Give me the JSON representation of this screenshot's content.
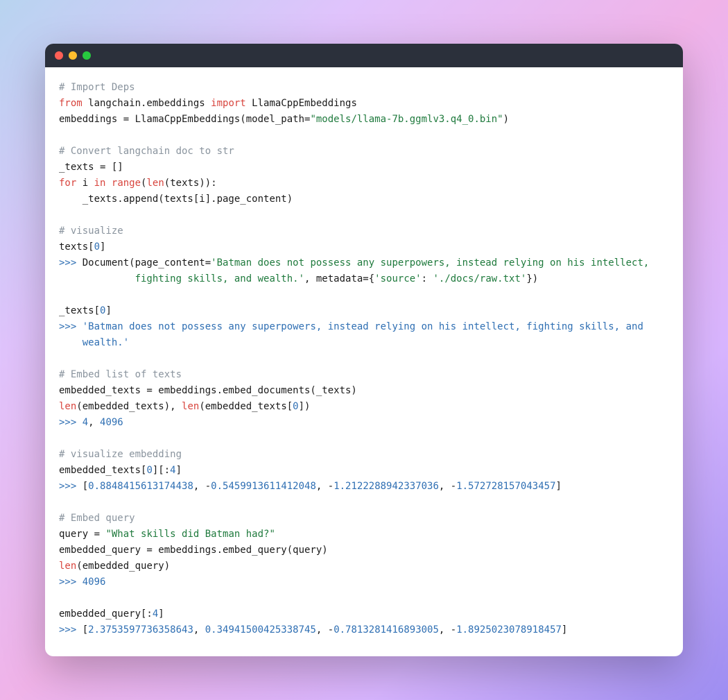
{
  "window": {
    "dots": [
      "close",
      "minimize",
      "zoom"
    ]
  },
  "code": {
    "comment_import": "# Import Deps",
    "kw_from": "from",
    "mod_langchain": " langchain.embeddings ",
    "kw_import": "import",
    "cls_llama": " LlamaCppEmbeddings",
    "assign_emb": "embeddings = LlamaCppEmbeddings(model_path=",
    "str_model": "\"models/llama-7b.ggmlv3.q4_0.bin\"",
    "paren_close": ")",
    "comment_convert": "# Convert langchain doc to str",
    "line_texts_init": "_texts = []",
    "kw_for": "for",
    "for_i": " i ",
    "kw_in": "in",
    "sp": " ",
    "fn_range": "range",
    "lp": "(",
    "fn_len": "len",
    "range_arg": "(texts)):",
    "indent": "    ",
    "append_line": "_texts.append(texts[i].page_content)",
    "comment_vis": "# visualize",
    "texts_idx": "texts[",
    "zero": "0",
    "rb": "]",
    "prompt": ">>> ",
    "doc_open": "Document(page_content=",
    "doc_str1": "'Batman does not possess any superpowers, instead relying on his intellect,",
    "doc_str1b_indent": "             ",
    "doc_str1b": "fighting skills, and wealth.'",
    "doc_meta": ", metadata={",
    "meta_k": "'source'",
    "colon": ": ",
    "meta_v": "'./docs/raw.txt'",
    "doc_close": "})",
    "texts2_idx": "_texts[",
    "out_str_a": "'Batman does not possess any superpowers, instead relying on his intellect, fighting skills, and",
    "out_indent": "    ",
    "out_str_b": "wealth.'",
    "comment_embedlist": "# Embed list of texts",
    "line_embed_docs": "embedded_texts = embeddings.embed_documents(_texts)",
    "len_call_a": "(embedded_texts), ",
    "len_call_b": "(embedded_texts[",
    "rb_paren": "])",
    "out_4": "4",
    "comma_sp": ", ",
    "out_4096": "4096",
    "comment_visemb": "# visualize embedding",
    "emb_idx_a": "embedded_texts[",
    "slice_open": "][:",
    "four": "4",
    "lbracket": "[",
    "v1": "0.8848415613174438",
    "v2": "0.5459913611412048",
    "v3": "1.2122288942337036",
    "v4": "1.572728157043457",
    "neg": "-",
    "rbracket": "]",
    "comment_embedq": "# Embed query",
    "query_assign": "query = ",
    "query_str": "\"What skills did Batman had?\"",
    "line_embed_query": "embedded_query = embeddings.embed_query(query)",
    "len_eq": "(embedded_query)",
    "eq_slice": "embedded_query[:",
    "q1": "2.3753597736358643",
    "q2": "0.34941500425338745",
    "q3": "0.7813281416893005",
    "q4": "1.8925023078918457"
  }
}
